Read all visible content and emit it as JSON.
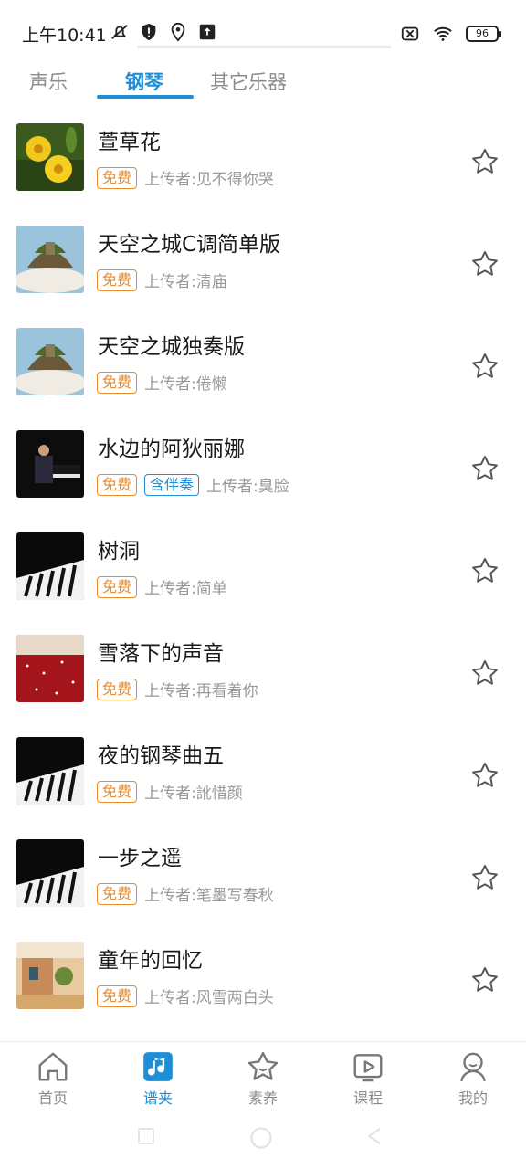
{
  "status": {
    "time": "上午10:41",
    "battery": "96"
  },
  "tabs": [
    {
      "label": "声乐"
    },
    {
      "label": "钢琴"
    },
    {
      "label": "其它乐器"
    }
  ],
  "list": [
    {
      "title": "萱草花",
      "free": "免费",
      "uploader": "上传者:见不得你哭"
    },
    {
      "title": "天空之城C调简单版",
      "free": "免费",
      "uploader": "上传者:清庙"
    },
    {
      "title": "天空之城独奏版",
      "free": "免费",
      "uploader": "上传者:倦懒"
    },
    {
      "title": "水边的阿狄丽娜",
      "free": "免费",
      "accompaniment": "含伴奏",
      "uploader": "上传者:臭脸"
    },
    {
      "title": "树洞",
      "free": "免费",
      "uploader": "上传者:简单"
    },
    {
      "title": "雪落下的声音",
      "free": "免费",
      "uploader": "上传者:再看着你"
    },
    {
      "title": "夜的钢琴曲五",
      "free": "免费",
      "uploader": "上传者:訛惜颜"
    },
    {
      "title": "一步之遥",
      "free": "免费",
      "uploader": "上传者:笔墨写春秋"
    },
    {
      "title": "童年的回忆",
      "free": "免费",
      "uploader": "上传者:风雪两白头"
    }
  ],
  "bottom_nav": [
    {
      "label": "首页"
    },
    {
      "label": "谱夹"
    },
    {
      "label": "素养"
    },
    {
      "label": "课程"
    },
    {
      "label": "我的"
    }
  ],
  "colors": {
    "accent": "#1e8fd6",
    "free_tag": "#e98a2b"
  }
}
